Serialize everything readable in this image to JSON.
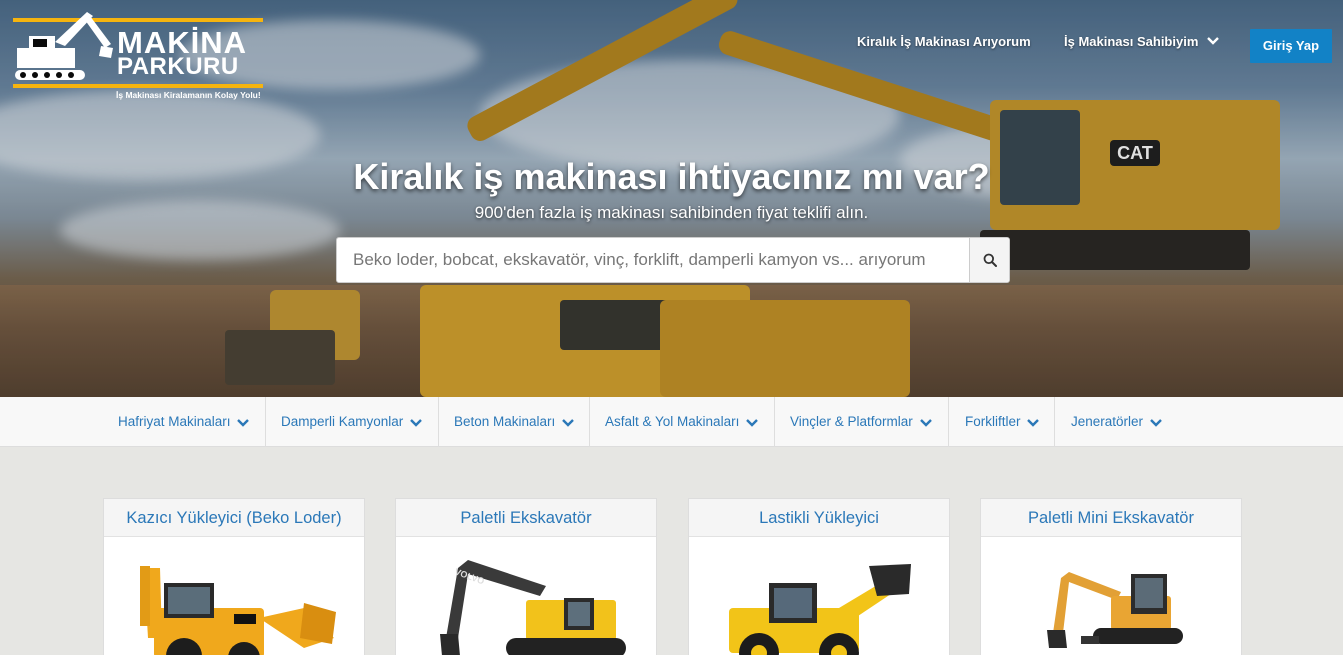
{
  "brand": {
    "line1": "MAKİNA",
    "line2": "PARKURU",
    "tagline": "İş Makinası Kiralamanın Kolay Yolu!",
    "accent_color": "#f6b40e"
  },
  "nav": {
    "links": [
      {
        "label": "Kiralık İş Makinası Arıyorum"
      },
      {
        "label": "İş Makinası Sahibiyim",
        "icon": "chevron-down-icon"
      }
    ],
    "login_label": "Giriş Yap",
    "login_color": "#1282c6"
  },
  "hero": {
    "title": "Kiralık iş makinası ihtiyacınız mı var?",
    "subtitle": "900'den fazla iş makinası sahibinden fiyat teklifi alın.",
    "search_placeholder": "Beko loder, bobcat, ekskavatör, vinç, forklift, damperli kamyon vs... arıyorum",
    "search_icon": "search-icon"
  },
  "categories": [
    {
      "label": "Hafriyat Makinaları"
    },
    {
      "label": "Damperli Kamyonlar"
    },
    {
      "label": "Beton Makinaları"
    },
    {
      "label": "Asfalt & Yol Makinaları"
    },
    {
      "label": "Vinçler & Platformlar"
    },
    {
      "label": "Forkliftler"
    },
    {
      "label": "Jeneratörler"
    }
  ],
  "cards": [
    {
      "title": "Kazıcı Yükleyici (Beko Loder)"
    },
    {
      "title": "Paletli Ekskavatör"
    },
    {
      "title": "Lastikli Yükleyici"
    },
    {
      "title": "Paletli Mini Ekskavatör"
    }
  ]
}
